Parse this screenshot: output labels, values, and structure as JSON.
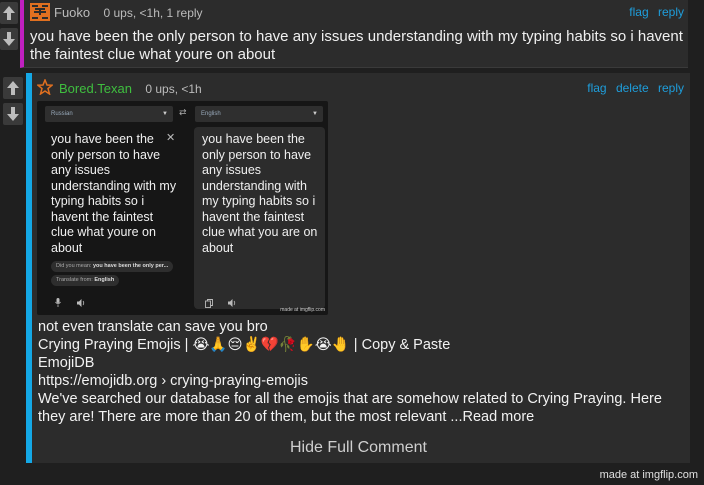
{
  "comment1": {
    "username": "Fuoko",
    "meta": "0 ups, <1h, 1 reply",
    "actions": [
      "flag",
      "reply"
    ],
    "text": "you have been the only person to have any issues understanding with my typing habits so i havent the faintest clue what youre on about",
    "line1": "you have been the only person to have any issues understanding with my typing habits so i havent",
    "line2": "the faintest clue what youre on about",
    "accent": "#c020c0"
  },
  "comment2": {
    "username": "Bored.Texan",
    "meta": "0 ups, <1h",
    "actions": [
      "flag",
      "delete",
      "reply"
    ],
    "accent": "#14a8e6",
    "translate_image": {
      "source_lang": "Russian",
      "target_lang": "English",
      "source_text": "you have been the only person to have any issues understanding with my typing habits so i havent the faintest clue what youre on about",
      "target_text": "you have been the only person to have any issues understanding with my typing habits so i havent the faintest clue what you are on about",
      "suggestion_prefix": "Did you mean:",
      "suggestion": "you have been the only per...",
      "translate_from_prefix": "Translate from:",
      "translate_from_lang": "English",
      "watermark": "made at imgflip.com"
    },
    "lines": [
      "not even translate can save you bro",
      "Crying Praying Emojis | 😭🙏😔✌️💔🥀✋😭🤚 | Copy & Paste",
      "EmojiDB",
      "https://emojidb.org › crying-praying-emojis",
      "We've searched our database for all the emojis that are somehow related to Crying Praying. Here",
      "they are! There are more than 20 of them, but the most relevant ...Read more"
    ],
    "hide_label": "Hide Full Comment"
  },
  "watermark": "made at imgflip.com",
  "colors": {
    "link": "#1e9edc",
    "username2": "#3fbf3f",
    "background": "#1f1f1f",
    "panel": "#2c2c2c"
  }
}
